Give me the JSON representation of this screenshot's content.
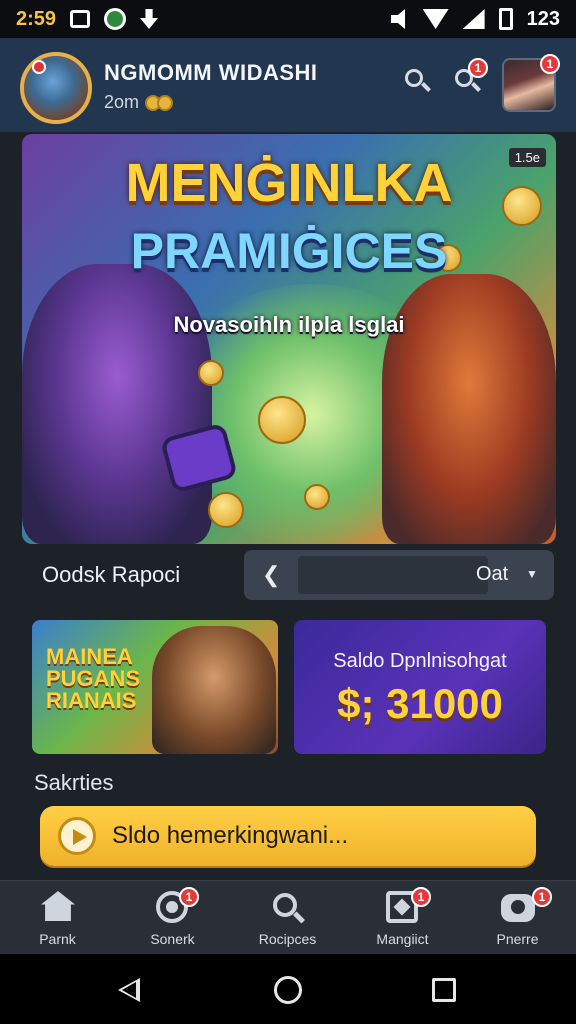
{
  "status_bar": {
    "time": "2:59",
    "right_text": "123"
  },
  "header": {
    "username": "NGMOMM WIDASHI",
    "coins_text": "2om"
  },
  "banner": {
    "title_line1": "MENĠINLKA",
    "title_line2": "PRAMIĠICES",
    "subtitle": "Novasoihln ilpla lsglai",
    "tag": "1.5e"
  },
  "filter": {
    "label": "Oodsk Rapoci",
    "selected": "Oat"
  },
  "cards": {
    "promo_title": "MAINEA PUGANS RIANAIS",
    "balance_label": "Saldo Dpnlnisohgat",
    "balance_value": "$; 31000"
  },
  "section": {
    "title": "Sakrties"
  },
  "loading_bar": {
    "text": "Sldo hemerkingwani..."
  },
  "tab_bar": {
    "tabs": [
      {
        "label": "Parnk",
        "icon": "home-icon",
        "badge": ""
      },
      {
        "label": "Sonerk",
        "icon": "target-icon",
        "badge": "1"
      },
      {
        "label": "Rocipces",
        "icon": "search-icon",
        "badge": ""
      },
      {
        "label": "Mangiict",
        "icon": "market-icon",
        "badge": "1"
      },
      {
        "label": "Pnerre",
        "icon": "profile-icon",
        "badge": "1"
      }
    ]
  },
  "badges": {
    "header_search": "1",
    "profile": "1"
  },
  "colors": {
    "header_bg": "#22364f",
    "accent_gold": "#ffd23a",
    "badge_red": "#e23a3a",
    "card_purple": "#5a32b8"
  }
}
